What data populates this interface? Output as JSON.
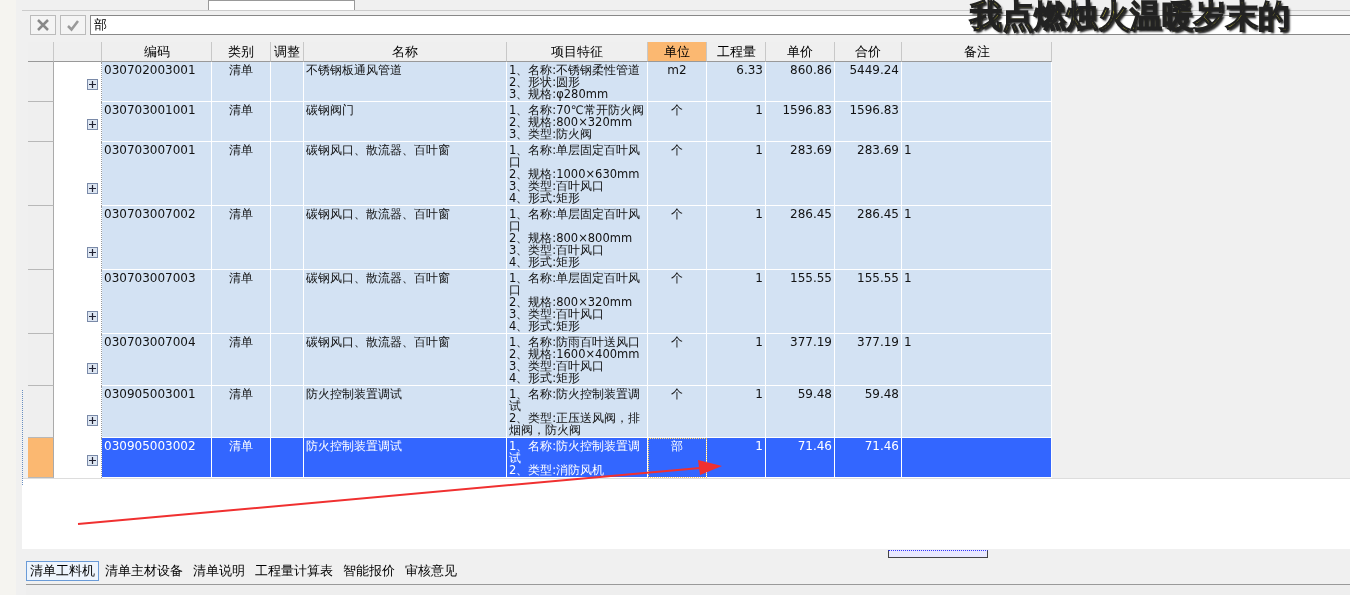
{
  "overlay_caption": "我点燃烛火温暖岁末的",
  "formula_bar": {
    "value": "部"
  },
  "table": {
    "columns": [
      {
        "label": "编码",
        "highlighted": false
      },
      {
        "label": "类别",
        "highlighted": false
      },
      {
        "label": "调整",
        "highlighted": false
      },
      {
        "label": "名称",
        "highlighted": false
      },
      {
        "label": "项目特征",
        "highlighted": false
      },
      {
        "label": "单位",
        "highlighted": true
      },
      {
        "label": "工程量",
        "highlighted": false
      },
      {
        "label": "单价",
        "highlighted": false
      },
      {
        "label": "合价",
        "highlighted": false
      },
      {
        "label": "备注",
        "highlighted": false
      }
    ],
    "rows": [
      {
        "code": "030702003001",
        "type": "清单",
        "name": "不锈钢板通风管道",
        "features": [
          "1、名称:不锈钢柔性管道",
          "2、形状:圆形",
          "3、规格:φ280mm"
        ],
        "unit": "m2",
        "quantity": "6.33",
        "price": "860.86",
        "total": "5449.24",
        "note": "",
        "expanded": false,
        "selected": false
      },
      {
        "code": "030703001001",
        "type": "清单",
        "name": "碳钢阀门",
        "features": [
          "1、名称:70℃常开防火阀",
          "2、规格:800×320mm",
          "3、类型:防火阀"
        ],
        "unit": "个",
        "quantity": "1",
        "price": "1596.83",
        "total": "1596.83",
        "note": "",
        "expanded": false,
        "selected": false
      },
      {
        "code": "030703007001",
        "type": "清单",
        "name": "碳钢风口、散流器、百叶窗",
        "features": [
          "1、名称:单层固定百叶风口",
          "2、规格:1000×630mm",
          "3、类型:百叶风口",
          "4、形式:矩形"
        ],
        "unit": "个",
        "quantity": "1",
        "price": "283.69",
        "total": "283.69",
        "note": "1",
        "expanded": false,
        "selected": false
      },
      {
        "code": "030703007002",
        "type": "清单",
        "name": "碳钢风口、散流器、百叶窗",
        "features": [
          "1、名称:单层固定百叶风口",
          "2、规格:800×800mm",
          "3、类型:百叶风口",
          "4、形式:矩形"
        ],
        "unit": "个",
        "quantity": "1",
        "price": "286.45",
        "total": "286.45",
        "note": "1",
        "expanded": false,
        "selected": false
      },
      {
        "code": "030703007003",
        "type": "清单",
        "name": "碳钢风口、散流器、百叶窗",
        "features": [
          "1、名称:单层固定百叶风口",
          "2、规格:800×320mm",
          "3、类型:百叶风口",
          "4、形式:矩形"
        ],
        "unit": "个",
        "quantity": "1",
        "price": "155.55",
        "total": "155.55",
        "note": "1",
        "expanded": false,
        "selected": false
      },
      {
        "code": "030703007004",
        "type": "清单",
        "name": "碳钢风口、散流器、百叶窗",
        "features": [
          "1、名称:防雨百叶送风口",
          "2、规格:1600×400mm",
          "3、类型:百叶风口",
          "4、形式:矩形"
        ],
        "unit": "个",
        "quantity": "1",
        "price": "377.19",
        "total": "377.19",
        "note": "1",
        "expanded": false,
        "selected": false
      },
      {
        "code": "030905003001",
        "type": "清单",
        "name": "防火控制装置调试",
        "features": [
          "1、名称:防火控制装置调试",
          "2、类型:正压送风阀，排烟阀，防火阀"
        ],
        "unit": "个",
        "quantity": "1",
        "price": "59.48",
        "total": "59.48",
        "note": "",
        "expanded": false,
        "selected": false
      },
      {
        "code": "030905003002",
        "type": "清单",
        "name": "防火控制装置调试",
        "features": [
          "1、名称:防火控制装置调试",
          "2、类型:消防风机"
        ],
        "unit": "部",
        "quantity": "1",
        "price": "71.46",
        "total": "71.46",
        "note": "",
        "expanded": false,
        "selected": true
      }
    ]
  },
  "bottom_tabs": [
    {
      "label": "清单工料机",
      "selected": true
    },
    {
      "label": "清单主材设备",
      "selected": false
    },
    {
      "label": "清单说明",
      "selected": false
    },
    {
      "label": "工程量计算表",
      "selected": false
    },
    {
      "label": "智能报价",
      "selected": false
    },
    {
      "label": "审核意见",
      "selected": false
    }
  ]
}
